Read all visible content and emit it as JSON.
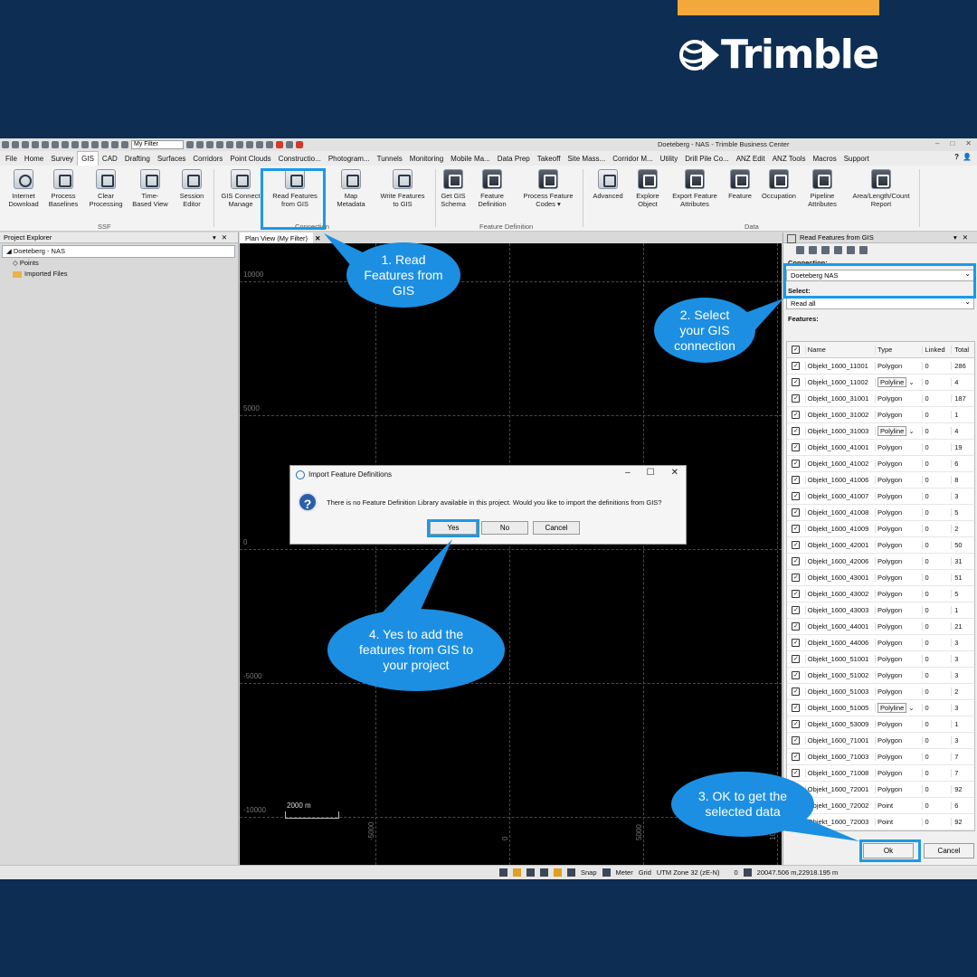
{
  "brand": {
    "name": "Trimble",
    "accent": "#f3a83b",
    "bg": "#0d2e52"
  },
  "window": {
    "title": "Doeteberg - NAS - Trimble Business Center",
    "filter_value": "My Filter"
  },
  "menu": {
    "items": [
      "File",
      "Home",
      "Survey",
      "GIS",
      "CAD",
      "Drafting",
      "Surfaces",
      "Corridors",
      "Point Clouds",
      "Constructio...",
      "Photogram...",
      "Tunnels",
      "Monitoring",
      "Mobile Ma...",
      "Data Prep",
      "Takeoff",
      "Site Mass...",
      "Corridor M...",
      "Utility",
      "Drill Pile Co...",
      "ANZ Edit",
      "ANZ Tools",
      "Macros",
      "Support"
    ],
    "active": "GIS"
  },
  "ribbon": {
    "buttons": [
      {
        "l1": "Internet",
        "l2": "Download",
        "icon": "internet-download-icon"
      },
      {
        "l1": "Process",
        "l2": "Baselines",
        "icon": "process-baselines-icon"
      },
      {
        "l1": "Clear",
        "l2": "Processing",
        "icon": "clear-processing-icon"
      },
      {
        "l1": "Time-",
        "l2": "Based View",
        "icon": "time-based-view-icon"
      },
      {
        "l1": "Session",
        "l2": "Editor",
        "icon": "session-editor-icon"
      },
      {
        "l1": "GIS Connect",
        "l2": "Manage",
        "icon": "gis-connect-icon"
      },
      {
        "l1": "Read Features",
        "l2": "from GIS",
        "icon": "read-features-icon"
      },
      {
        "l1": "Map",
        "l2": "Metadata",
        "icon": "map-metadata-icon"
      },
      {
        "l1": "Write Features",
        "l2": "to GIS",
        "icon": "write-features-icon"
      },
      {
        "l1": "Get GIS",
        "l2": "Schema",
        "icon": "get-schema-icon"
      },
      {
        "l1": "Feature",
        "l2": "Definition",
        "icon": "feature-definition-icon"
      },
      {
        "l1": "Process Feature",
        "l2": "Codes ▾",
        "icon": "process-codes-icon"
      },
      {
        "l1": "Advanced",
        "l2": "",
        "icon": "advanced-icon"
      },
      {
        "l1": "Explore",
        "l2": "Object",
        "icon": "explore-object-icon"
      },
      {
        "l1": "Export Feature",
        "l2": "Attributes",
        "icon": "export-attributes-icon"
      },
      {
        "l1": "Feature",
        "l2": "",
        "icon": "feature-icon"
      },
      {
        "l1": "Occupation",
        "l2": "",
        "icon": "occupation-icon"
      },
      {
        "l1": "Pipeline",
        "l2": "Attributes",
        "icon": "pipeline-icon"
      },
      {
        "l1": "Area/Length/Count",
        "l2": "Report",
        "icon": "report-icon"
      }
    ],
    "groups": {
      "ssf": "SSF",
      "connection": "Connection",
      "feature_definition": "Feature Definition",
      "data": "Data"
    }
  },
  "project_explorer": {
    "title": "Project Explorer",
    "root": "Doeteberg - NAS",
    "children": [
      "Points",
      "Imported Files"
    ]
  },
  "plan_view": {
    "tab": "Plan View (My Filter)",
    "y_labels": [
      "10000",
      "5000",
      "0",
      "-5000",
      "-10000"
    ],
    "x_labels": [
      "-5000",
      "0",
      "5000",
      "10000"
    ],
    "scale": "2000 m"
  },
  "read_features": {
    "title": "Read Features from GIS",
    "connection_label": "Connection:",
    "connection_value": "Doeteberg NAS",
    "select_label": "Select:",
    "select_value": "Read all",
    "features_label": "Features:",
    "columns": [
      "Name",
      "Type",
      "Linked",
      "Total"
    ],
    "rows": [
      {
        "name": "Objekt_1600_11001",
        "type": "Polygon",
        "linked": "0",
        "total": "286"
      },
      {
        "name": "Objekt_1600_11002",
        "type": "Polyline",
        "linked": "0",
        "total": "4",
        "box": true
      },
      {
        "name": "Objekt_1600_31001",
        "type": "Polygon",
        "linked": "0",
        "total": "187"
      },
      {
        "name": "Objekt_1600_31002",
        "type": "Polygon",
        "linked": "0",
        "total": "1"
      },
      {
        "name": "Objekt_1600_31003",
        "type": "Polyline",
        "linked": "0",
        "total": "4",
        "box": true
      },
      {
        "name": "Objekt_1600_41001",
        "type": "Polygon",
        "linked": "0",
        "total": "19"
      },
      {
        "name": "Objekt_1600_41002",
        "type": "Polygon",
        "linked": "0",
        "total": "6"
      },
      {
        "name": "Objekt_1600_41006",
        "type": "Polygon",
        "linked": "0",
        "total": "8"
      },
      {
        "name": "Objekt_1600_41007",
        "type": "Polygon",
        "linked": "0",
        "total": "3"
      },
      {
        "name": "Objekt_1600_41008",
        "type": "Polygon",
        "linked": "0",
        "total": "5"
      },
      {
        "name": "Objekt_1600_41009",
        "type": "Polygon",
        "linked": "0",
        "total": "2"
      },
      {
        "name": "Objekt_1600_42001",
        "type": "Polygon",
        "linked": "0",
        "total": "50"
      },
      {
        "name": "Objekt_1600_42006",
        "type": "Polygon",
        "linked": "0",
        "total": "31"
      },
      {
        "name": "Objekt_1600_43001",
        "type": "Polygon",
        "linked": "0",
        "total": "51"
      },
      {
        "name": "Objekt_1600_43002",
        "type": "Polygon",
        "linked": "0",
        "total": "5"
      },
      {
        "name": "Objekt_1600_43003",
        "type": "Polygon",
        "linked": "0",
        "total": "1"
      },
      {
        "name": "Objekt_1600_44001",
        "type": "Polygon",
        "linked": "0",
        "total": "21"
      },
      {
        "name": "Objekt_1600_44006",
        "type": "Polygon",
        "linked": "0",
        "total": "3"
      },
      {
        "name": "Objekt_1600_51001",
        "type": "Polygon",
        "linked": "0",
        "total": "3"
      },
      {
        "name": "Objekt_1600_51002",
        "type": "Polygon",
        "linked": "0",
        "total": "3"
      },
      {
        "name": "Objekt_1600_51003",
        "type": "Polygon",
        "linked": "0",
        "total": "2"
      },
      {
        "name": "Objekt_1600_51005",
        "type": "Polyline",
        "linked": "0",
        "total": "3",
        "box": true
      },
      {
        "name": "Objekt_1600_53009",
        "type": "Polygon",
        "linked": "0",
        "total": "1"
      },
      {
        "name": "Objekt_1600_71001",
        "type": "Polygon",
        "linked": "0",
        "total": "3"
      },
      {
        "name": "Objekt_1600_71003",
        "type": "Polygon",
        "linked": "0",
        "total": "7"
      },
      {
        "name": "Objekt_1600_71008",
        "type": "Polygon",
        "linked": "0",
        "total": "7"
      },
      {
        "name": "Objekt_1600_72001",
        "type": "Polygon",
        "linked": "0",
        "total": "92"
      },
      {
        "name": "Objekt_1600_72002",
        "type": "Point",
        "linked": "0",
        "total": "6"
      },
      {
        "name": "Objekt_1600_72003",
        "type": "Point",
        "linked": "0",
        "total": "92"
      }
    ],
    "ok": "Ok",
    "cancel": "Cancel"
  },
  "dialog": {
    "title": "Import Feature Definitions",
    "message": "There is no Feature Definition Library available in this project. Would you like to import the definitions from GIS?",
    "yes": "Yes",
    "no": "No",
    "cancel": "Cancel"
  },
  "statusbar": {
    "snap": "Snap",
    "units": "Meter",
    "grid": "Grid",
    "zone": "UTM Zone 32 (zE-N)",
    "count": "0",
    "coords": "20047.506 m,22918.195 m"
  },
  "callouts": {
    "c1": [
      "1. Read",
      "Features from",
      "GIS"
    ],
    "c2": [
      "2. Select",
      "your GIS",
      "connection"
    ],
    "c3": [
      "3. OK to get the",
      "selected data"
    ],
    "c4": [
      "4. Yes to add the",
      "features from GIS to",
      "your project"
    ],
    "color": "#1c8fe2",
    "highlight": "#1a9ae8"
  }
}
